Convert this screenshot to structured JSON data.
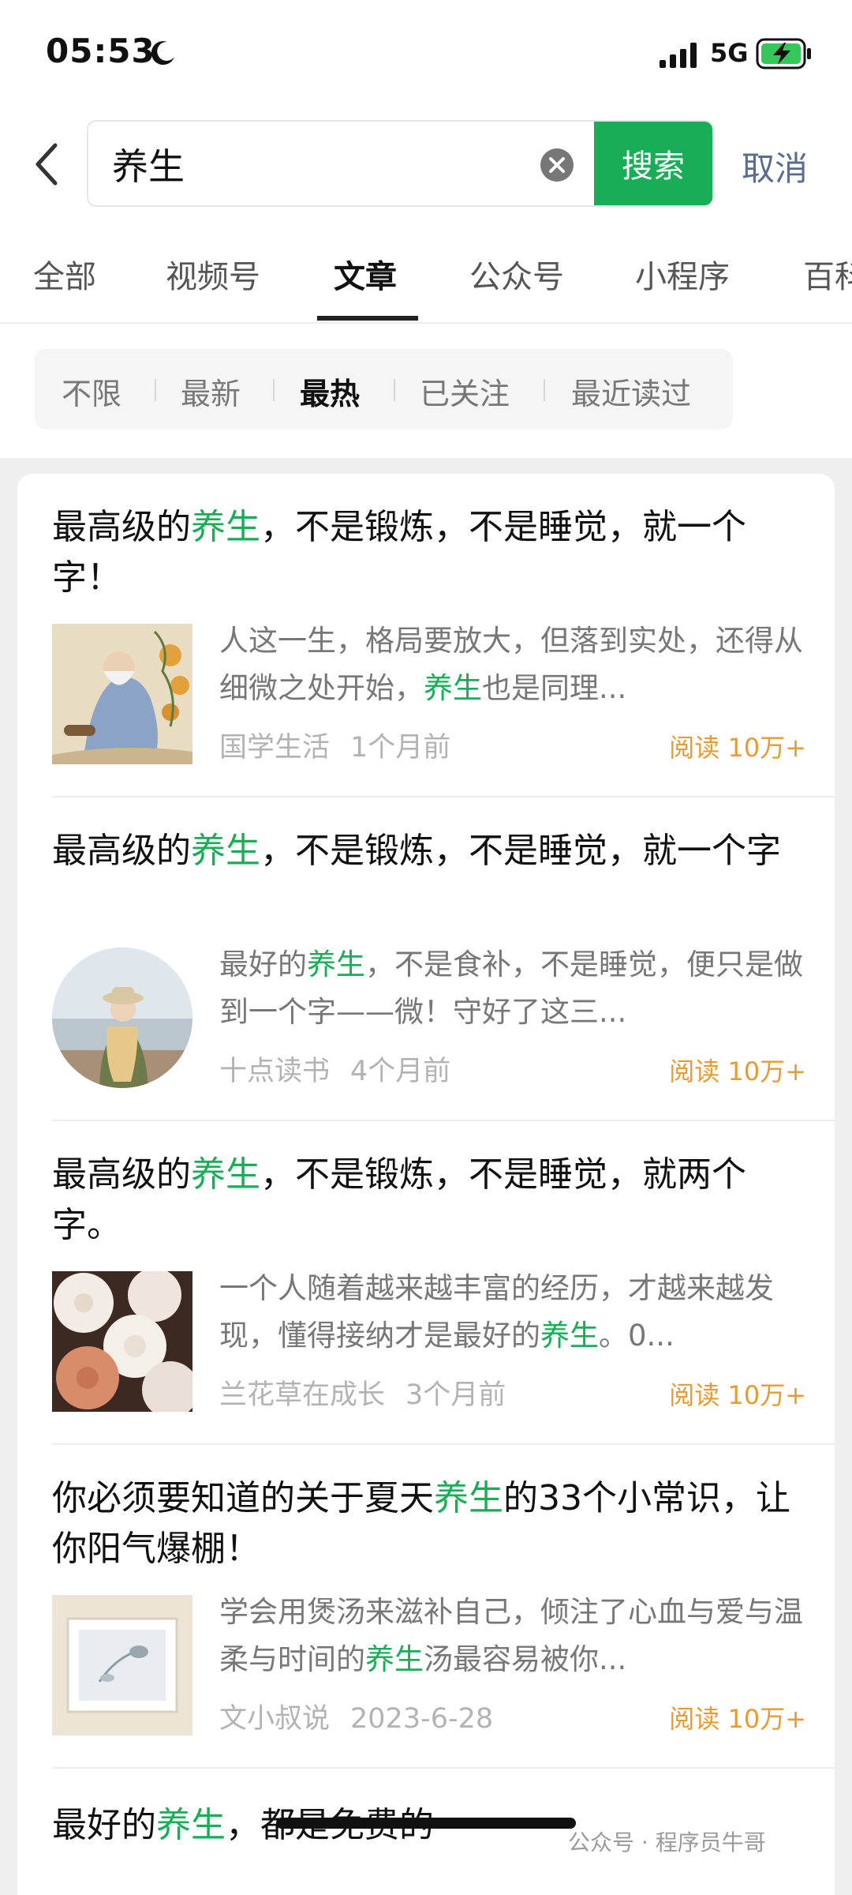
{
  "status_bar": {
    "time": "05:53",
    "network": "5G"
  },
  "search": {
    "query": "养生",
    "placeholder": "",
    "button_label": "搜索",
    "cancel_label": "取消"
  },
  "tabs": [
    {
      "label": "全部"
    },
    {
      "label": "视频号"
    },
    {
      "label": "文章",
      "active": true
    },
    {
      "label": "公众号"
    },
    {
      "label": "小程序"
    },
    {
      "label": "百科"
    }
  ],
  "filters": [
    {
      "label": "不限"
    },
    {
      "label": "最新"
    },
    {
      "label": "最热",
      "active": true
    },
    {
      "label": "已关注"
    },
    {
      "label": "最近读过"
    }
  ],
  "results": [
    {
      "title_before": "最高级的",
      "title_keyword": "养生",
      "title_after": "，不是锻炼，不是睡觉，就一个字！",
      "snippet_before": "人这一生，格局要放大，但落到实处，还得从细微之处开始，",
      "snippet_keyword": "养生",
      "snippet_after": "也是同理...",
      "source": "国学生活",
      "date": "1个月前",
      "reads": "阅读 10万+"
    },
    {
      "title_before": "最高级的",
      "title_keyword": "养生",
      "title_after": "，不是锻炼，不是睡觉，就一个字",
      "snippet_before": "最好的",
      "snippet_keyword": "养生",
      "snippet_after": "，不是食补，不是睡觉，便只是做到一个字——微！守好了这三...",
      "source": "十点读书",
      "date": "4个月前",
      "reads": "阅读 10万+"
    },
    {
      "title_before": "最高级的",
      "title_keyword": "养生",
      "title_after": "，不是锻炼，不是睡觉，就两个字。",
      "snippet_before": "一个人随着越来越丰富的经历，才越来越发现，懂得接纳才是最好的",
      "snippet_keyword": "养生",
      "snippet_after": "。0...",
      "source": "兰花草在成长",
      "date": "3个月前",
      "reads": "阅读 10万+"
    },
    {
      "title_before": "你必须要知道的关于夏天",
      "title_keyword": "养生",
      "title_after": "的33个小常识，让你阳气爆棚！",
      "snippet_before": "学会用煲汤来滋补自己，倾注了心血与爱与温柔与时间的",
      "snippet_keyword": "养生",
      "snippet_after": "汤最容易被你...",
      "source": "文小叔说",
      "date": "2023-6-28",
      "reads": "阅读 10万+"
    },
    {
      "title_before": "最好的",
      "title_keyword": "养生",
      "title_after": "，都是免费的"
    }
  ],
  "watermark": "公众号 · 程序员牛哥",
  "colors": {
    "accent_green": "#1aad57",
    "cancel_blue": "#5b6b92",
    "reads_orange": "#e89b2e"
  },
  "icons": [
    "moon-icon",
    "signal-icon",
    "battery-charging-icon",
    "back-icon",
    "clear-icon"
  ]
}
